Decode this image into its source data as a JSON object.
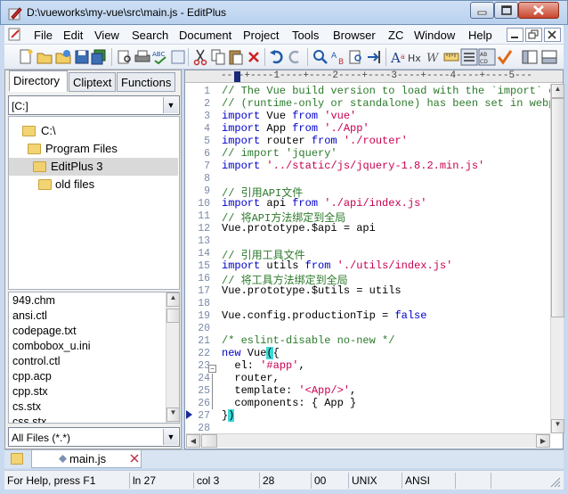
{
  "window": {
    "title": "D:\\vueworks\\my-vue\\src\\main.js - EditPlus"
  },
  "menu": [
    "File",
    "Edit",
    "View",
    "Search",
    "Document",
    "Project",
    "Tools",
    "Browser",
    "ZC",
    "Window",
    "Help"
  ],
  "left_panel": {
    "tabs": [
      "Directory",
      "Cliptext",
      "Functions"
    ],
    "drive": "[C:]",
    "tree": [
      "C:\\",
      "Program Files",
      "EditPlus 3",
      "old files"
    ],
    "files": [
      "949.chm",
      "ansi.ctl",
      "codepage.txt",
      "combobox_u.ini",
      "control.ctl",
      "cpp.acp",
      "cpp.stx",
      "cs.stx",
      "css.stx"
    ],
    "filter": "All Files (*.*)"
  },
  "editor": {
    "ruler": "----+----1----+----2----+----3----+----4----+----5---",
    "lines": [
      {
        "n": "1",
        "t": "// The Vue build version to load with the `import` c"
      },
      {
        "n": "2",
        "t": "// (runtime-only or standalone) has been set in webp"
      },
      {
        "n": "3",
        "t": "import Vue from 'vue'"
      },
      {
        "n": "4",
        "t": "import App from './App'"
      },
      {
        "n": "5",
        "t": "import router from './router'"
      },
      {
        "n": "6",
        "t": "// import 'jquery'"
      },
      {
        "n": "7",
        "t": "import '../static/js/jquery-1.8.2.min.js'"
      },
      {
        "n": "8",
        "t": ""
      },
      {
        "n": "9",
        "t": "// 引用API文件"
      },
      {
        "n": "10",
        "t": "import api from './api/index.js'"
      },
      {
        "n": "11",
        "t": "// 将API方法绑定到全局"
      },
      {
        "n": "12",
        "t": "Vue.prototype.$api = api"
      },
      {
        "n": "13",
        "t": ""
      },
      {
        "n": "14",
        "t": "// 引用工具文件"
      },
      {
        "n": "15",
        "t": "import utils from './utils/index.js'"
      },
      {
        "n": "16",
        "t": "// 将工具方法绑定到全局"
      },
      {
        "n": "17",
        "t": "Vue.prototype.$utils = utils"
      },
      {
        "n": "18",
        "t": ""
      },
      {
        "n": "19",
        "t": "Vue.config.productionTip = false"
      },
      {
        "n": "20",
        "t": ""
      },
      {
        "n": "21",
        "t": "/* eslint-disable no-new */"
      },
      {
        "n": "22",
        "t": "new Vue({"
      },
      {
        "n": "23",
        "t": "  el: '#app',"
      },
      {
        "n": "24",
        "t": "  router,"
      },
      {
        "n": "25",
        "t": "  template: '<App/>',"
      },
      {
        "n": "26",
        "t": "  components: { App }"
      },
      {
        "n": "27",
        "t": "})"
      },
      {
        "n": "28",
        "t": ""
      }
    ]
  },
  "doc_tab": "main.js",
  "status": {
    "help": "For Help, press F1",
    "line": "ln 27",
    "col": "col 3",
    "total": "28",
    "chars": "00",
    "format": "UNIX",
    "encoding": "ANSI"
  }
}
